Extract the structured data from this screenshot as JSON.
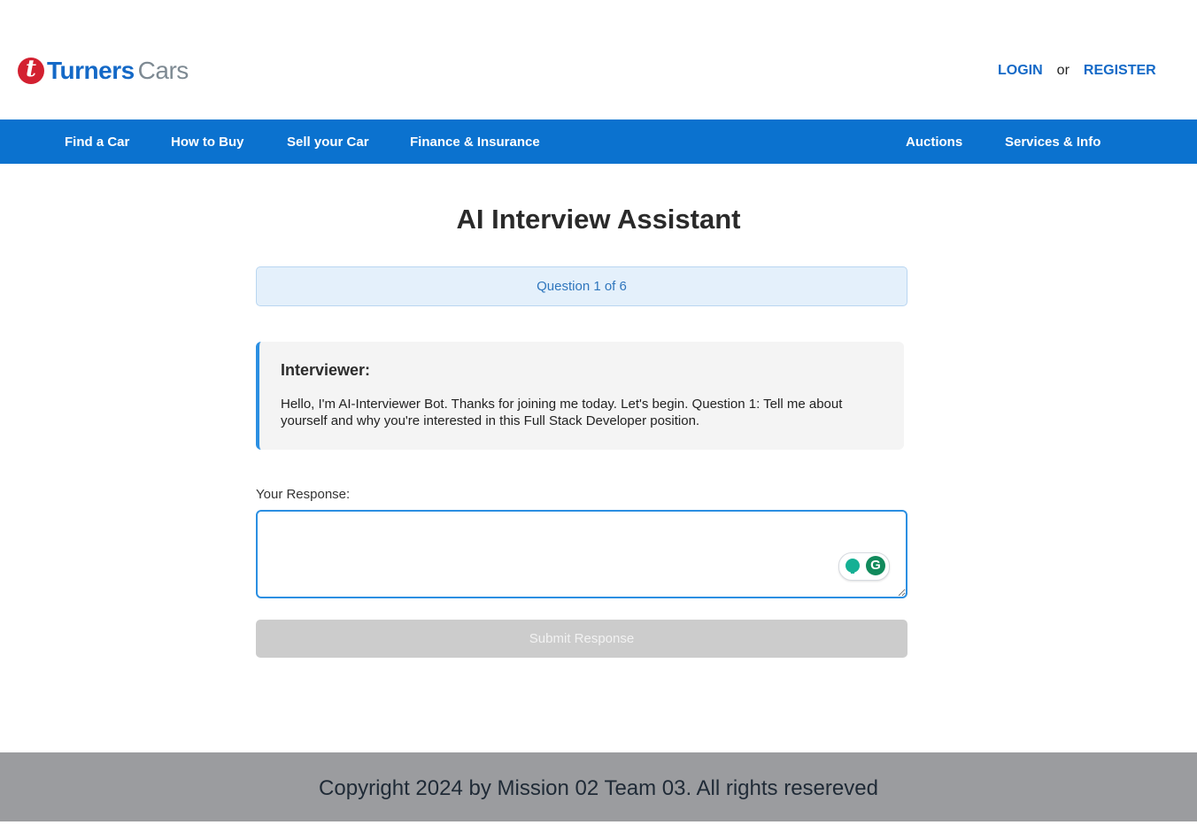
{
  "brand": {
    "name_part1": "Turners",
    "name_part2": "Cars",
    "badge_letter": "t",
    "colors": {
      "red": "#d32030",
      "blue": "#1469c7",
      "grey": "#7e8a93"
    }
  },
  "auth": {
    "login": "LOGIN",
    "or": "or",
    "register": "REGISTER"
  },
  "nav": {
    "background": "#0b72cf",
    "items": [
      {
        "label": "Find a Car"
      },
      {
        "label": "How to Buy"
      },
      {
        "label": "Sell your Car"
      },
      {
        "label": "Finance & Insurance"
      },
      {
        "label": "Auctions"
      },
      {
        "label": "Services & Info"
      }
    ]
  },
  "main": {
    "title": "AI Interview Assistant",
    "progress": "Question 1 of 6",
    "interviewer": {
      "label": "Interviewer:",
      "message": "Hello, I'm AI-Interviewer Bot. Thanks for joining me today. Let's begin. Question 1: Tell me about yourself and why you're interested in this Full Stack Developer position."
    },
    "response": {
      "label": "Your Response:",
      "value": "",
      "placeholder": ""
    },
    "submit_label": "Submit Response"
  },
  "icons": {
    "brand": "turners-logo-icon",
    "grammarly_bulb": "lightbulb-icon",
    "grammarly_g": "grammarly-icon"
  },
  "footer": {
    "text": "Copyright 2024 by Mission 02 Team 03. All rights resereved"
  }
}
